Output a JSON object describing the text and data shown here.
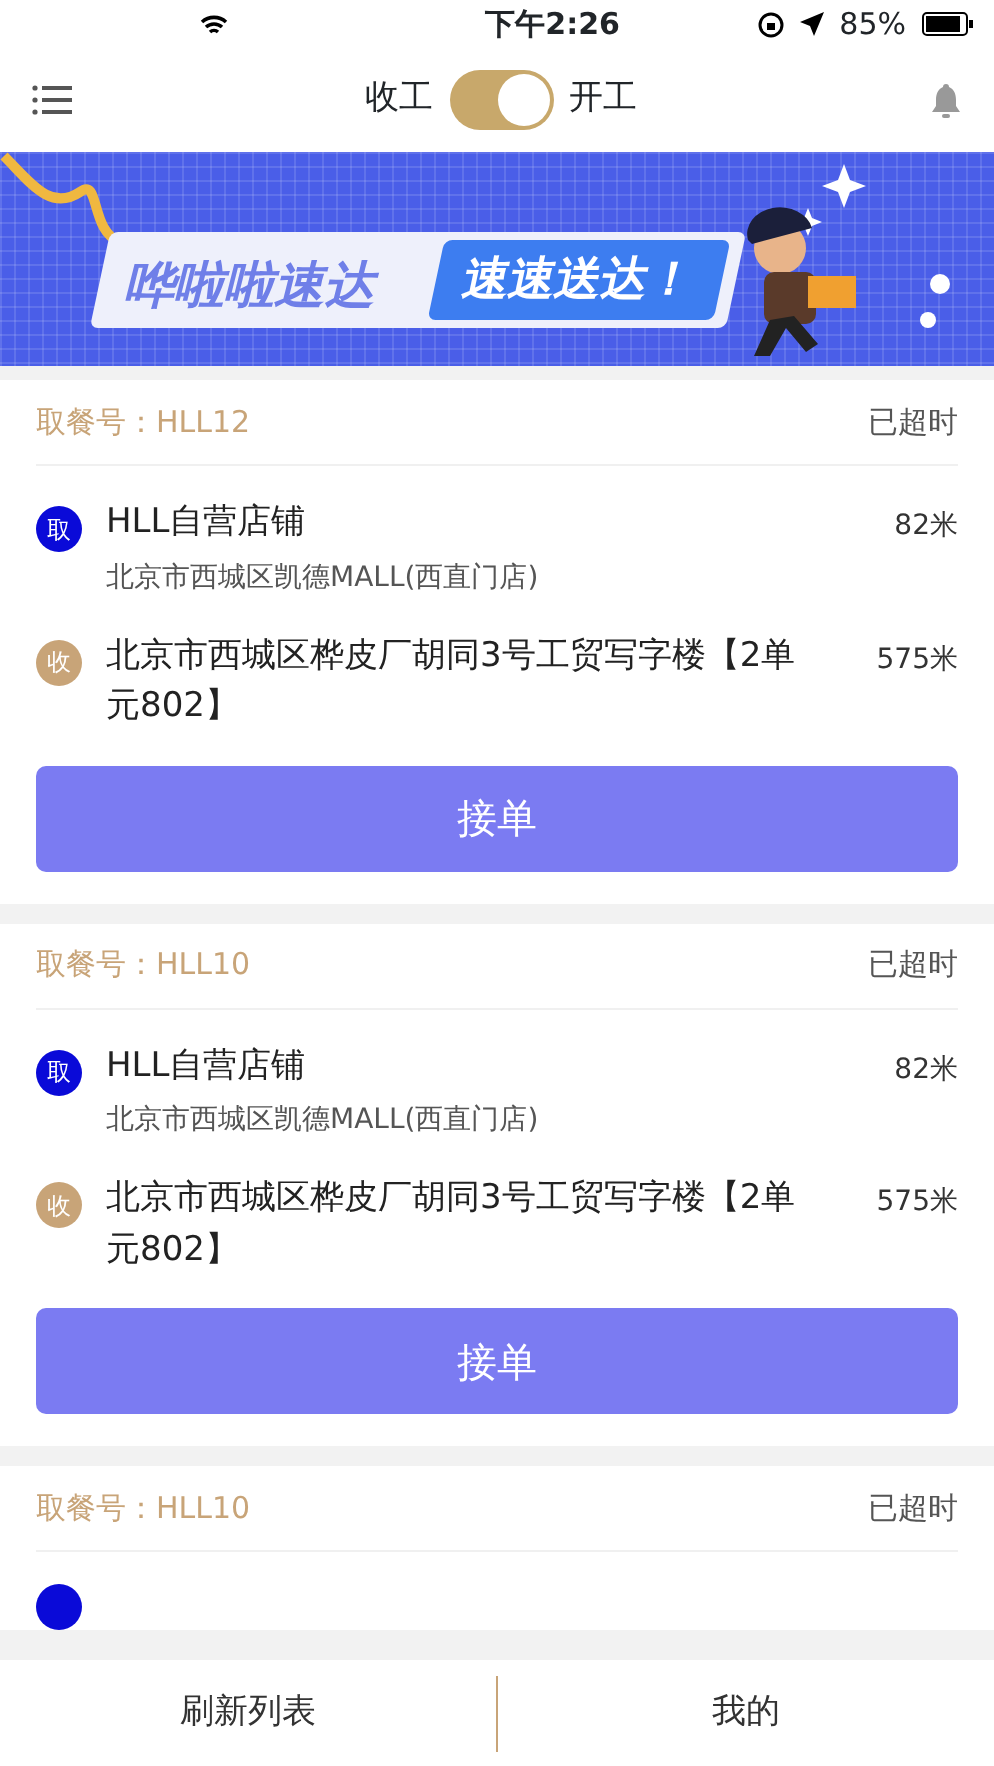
{
  "status_bar": {
    "time": "下午2:26",
    "battery": "85%"
  },
  "header": {
    "off_label": "收工",
    "on_label": "开工",
    "on": true
  },
  "banner": {
    "title": "哗啦啦速达",
    "slogan": "速速送达！"
  },
  "orders": [
    {
      "code": "取餐号：HLL12",
      "status": "已超时",
      "pickup": {
        "badge": "取",
        "name": "HLL自营店铺",
        "address": "北京市西城区凯德MALL(西直门店)",
        "distance": "82米"
      },
      "dropoff": {
        "badge": "收",
        "address": "北京市西城区桦皮厂胡同3号工贸写字楼【2单元802】",
        "distance": "575米"
      },
      "button": "接单"
    },
    {
      "code": "取餐号：HLL10",
      "status": "已超时",
      "pickup": {
        "badge": "取",
        "name": "HLL自营店铺",
        "address": "北京市西城区凯德MALL(西直门店)",
        "distance": "82米"
      },
      "dropoff": {
        "badge": "收",
        "address": "北京市西城区桦皮厂胡同3号工贸写字楼【2单元802】",
        "distance": "575米"
      },
      "button": "接单"
    },
    {
      "code": "取餐号：HLL10",
      "status": "已超时"
    }
  ],
  "bottom_bar": [
    "刷新列表",
    "我的"
  ]
}
